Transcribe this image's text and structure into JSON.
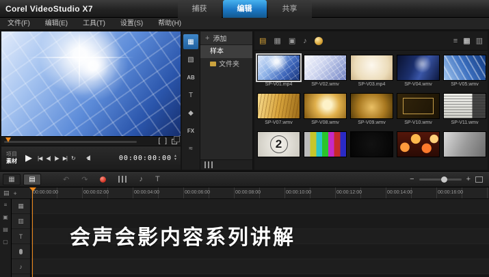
{
  "colors": {
    "accent_blue": "#1d8be0",
    "accent_orange": "#ef8a1d"
  },
  "titlebar": {
    "app_title": "Corel VideoStudio X7",
    "tabs": [
      {
        "label": "捕获",
        "active": false
      },
      {
        "label": "编辑",
        "active": true
      },
      {
        "label": "共享",
        "active": false
      }
    ]
  },
  "menubar": {
    "items": [
      "文件(F)",
      "编辑(E)",
      "工具(T)",
      "设置(S)",
      "帮助(H)"
    ]
  },
  "preview": {
    "project_label": "项目",
    "clip_label": "素材",
    "timecode": "00:00:00:00"
  },
  "tool_strip": {
    "transition_label": "AB",
    "title_label": "T",
    "filter_label": "FX"
  },
  "library_nav": {
    "add_label": "添加",
    "sample_label": "样本",
    "folder_label": "文件夹"
  },
  "gallery": {
    "countdown_number": "2",
    "items": [
      {
        "label": "SP-V01.mp4"
      },
      {
        "label": "SP-V02.wmv"
      },
      {
        "label": "SP-V03.mp4"
      },
      {
        "label": "SP-V04.wmv"
      },
      {
        "label": "SP-V05.wmv"
      },
      {
        "label": "SP-V07.wmv"
      },
      {
        "label": "SP-V08.wmv"
      },
      {
        "label": "SP-V09.wmv"
      },
      {
        "label": "SP-V10.wmv"
      },
      {
        "label": "SP-V11.wmv"
      },
      {
        "label": ""
      },
      {
        "label": ""
      },
      {
        "label": ""
      },
      {
        "label": ""
      },
      {
        "label": ""
      }
    ]
  },
  "timeline": {
    "ruler": [
      "00:00:00:00",
      "00:00:02:00",
      "00:00:04:00",
      "00:00:06:00",
      "00:00:08:00",
      "00:00:10:00",
      "00:00:12:00",
      "00:00:14:00",
      "00:00:16:00"
    ]
  },
  "overlay_text": "会声会影内容系列讲解",
  "icons": {
    "play": "▶",
    "home": "|◀",
    "prev_frame": "◀|",
    "next_frame": "|▶",
    "end_btn": "▶|",
    "repeat": "↻",
    "mark_in": "[",
    "mark_out": "]",
    "up": "▲",
    "down": "▼",
    "add": "+",
    "media": "▦",
    "instant_project": "▧",
    "graphic": "◆",
    "motion": "≈",
    "folder_filter": "▤",
    "video_filter": "▦",
    "photo_filter": "▣",
    "music_note": "♪",
    "list_view": "≡",
    "grid_view": "▦",
    "detail_view": "▥",
    "storyboard_view": "▦",
    "timeline_view": "▤",
    "undo": "↶",
    "redo": "↷",
    "zoom_out": "−",
    "zoom_in": "+",
    "subtitle": "T",
    "track_video": "▦",
    "track_overlay": "▥",
    "track_title": "T",
    "track_music": "♪",
    "corner_tracks": "▤",
    "corner_add": "+",
    "rail_1": "≡",
    "rail_2": "▣",
    "rail_3": "▤",
    "rail_4": "▢"
  }
}
